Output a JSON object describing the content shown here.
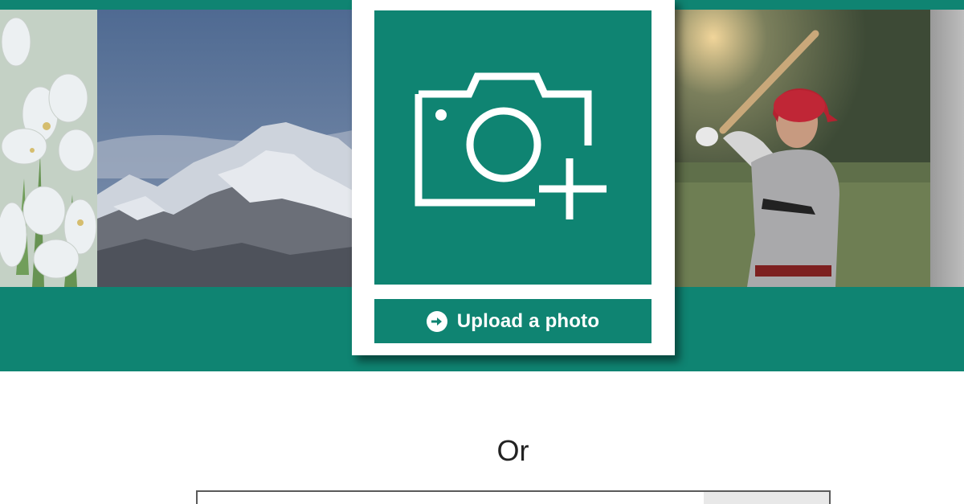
{
  "upload": {
    "button_label": "Upload a photo"
  },
  "divider": {
    "text": "Or"
  },
  "url_field": {
    "value": "",
    "placeholder": ""
  },
  "colors": {
    "brand_teal": "#0f8472",
    "background": "#ffffff"
  },
  "icons": {
    "camera": "camera-plus-icon",
    "arrow": "arrow-right-circle-icon"
  }
}
